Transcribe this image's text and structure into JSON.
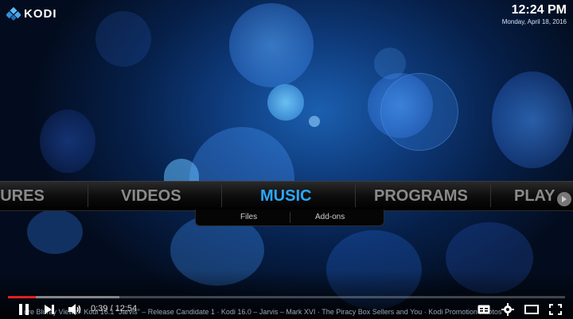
{
  "app": {
    "name": "KODI"
  },
  "clock": {
    "time": "12:24 PM",
    "date": "Monday, April 18, 2016"
  },
  "main_menu": {
    "items": [
      "TURES",
      "VIDEOS",
      "MUSIC",
      "PROGRAMS",
      "PLAY"
    ],
    "active": "MUSIC"
  },
  "submenu": {
    "items": [
      "Files",
      "Add-ons"
    ]
  },
  "player": {
    "current_time": "0:39",
    "separator": " / ",
    "duration": "12:54",
    "progress_fraction": 0.05,
    "buffer_fraction": 0.2,
    "ticker": "ure Bluray Views · Kodi 16.1 \"Jarvis\" – Release Candidate 1 · Kodi 16.0 – Jarvis – Mark XVI · The Piracy Box Sellers and You · Kodi Promotion Photos"
  },
  "colors": {
    "accent": "#2aa7ff",
    "progress": "#e02020"
  },
  "icons": {
    "logo": "kodi-logo-icon",
    "pause": "pause-icon",
    "next": "next-icon",
    "volume": "volume-icon",
    "captions": "captions-icon",
    "settings": "gear-icon",
    "theater": "theater-mode-icon",
    "fullscreen": "fullscreen-icon"
  }
}
